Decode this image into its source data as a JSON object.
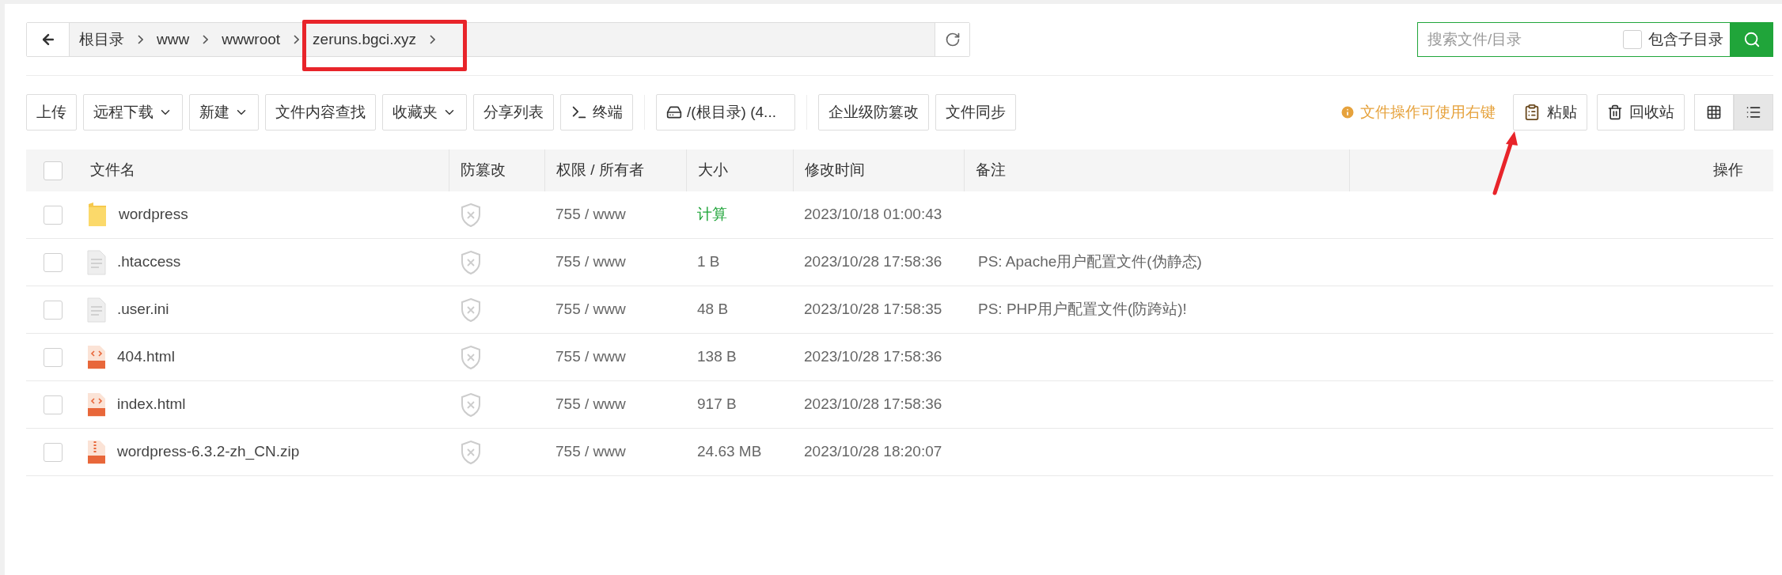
{
  "breadcrumb": [
    "根目录",
    "www",
    "wwwroot",
    "zeruns.bgci.xyz"
  ],
  "search": {
    "placeholder": "搜索文件/目录",
    "subdir_label": "包含子目录",
    "subdir_checked": false
  },
  "toolbar": [
    {
      "label": "上传",
      "kind": "plain"
    },
    {
      "label": "远程下载",
      "kind": "dropdown"
    },
    {
      "label": "新建",
      "kind": "dropdown"
    },
    {
      "label": "文件内容查找",
      "kind": "plain"
    },
    {
      "label": "收藏夹",
      "kind": "dropdown"
    },
    {
      "label": "分享列表",
      "kind": "plain"
    },
    {
      "label": "终端",
      "kind": "terminal"
    },
    {
      "label": "/(根目录) (4...",
      "kind": "disk"
    },
    {
      "label": "企业级防篡改",
      "kind": "plain"
    },
    {
      "label": "文件同步",
      "kind": "plain"
    }
  ],
  "hint": "文件操作可使用右键",
  "actions": [
    {
      "label": "粘贴",
      "kind": "paste"
    },
    {
      "label": "回收站",
      "kind": "trash"
    }
  ],
  "views": [
    {
      "kind": "grid",
      "selected": false
    },
    {
      "kind": "list",
      "selected": true
    }
  ],
  "table": {
    "select_all_checked": false,
    "columns": [
      "文件名",
      "防篡改",
      "权限 / 所有者",
      "大小",
      "修改时间",
      "备注",
      "操作"
    ],
    "rows": [
      {
        "checked": false,
        "kind": "folder",
        "name": "wordpress",
        "perm": "755 / www",
        "size": "计算",
        "size_action": true,
        "time": "2023/10/18 01:00:43",
        "note": ""
      },
      {
        "checked": false,
        "kind": "text",
        "name": ".htaccess",
        "perm": "755 / www",
        "size": "1 B",
        "size_action": false,
        "time": "2023/10/28 17:58:36",
        "note": "PS: Apache用户配置文件(伪静态)"
      },
      {
        "checked": false,
        "kind": "text",
        "name": ".user.ini",
        "perm": "755 / www",
        "size": "48 B",
        "size_action": false,
        "time": "2023/10/28 17:58:35",
        "note": "PS: PHP用户配置文件(防跨站)!"
      },
      {
        "checked": false,
        "kind": "html",
        "name": "404.html",
        "perm": "755 / www",
        "size": "138 B",
        "size_action": false,
        "time": "2023/10/28 17:58:36",
        "note": ""
      },
      {
        "checked": false,
        "kind": "html",
        "name": "index.html",
        "perm": "755 / www",
        "size": "917 B",
        "size_action": false,
        "time": "2023/10/28 17:58:36",
        "note": ""
      },
      {
        "checked": false,
        "kind": "zip",
        "name": "wordpress-6.3.2-zh_CN.zip",
        "perm": "755 / www",
        "size": "24.63 MB",
        "size_action": false,
        "time": "2023/10/28 18:20:07",
        "note": ""
      }
    ]
  }
}
